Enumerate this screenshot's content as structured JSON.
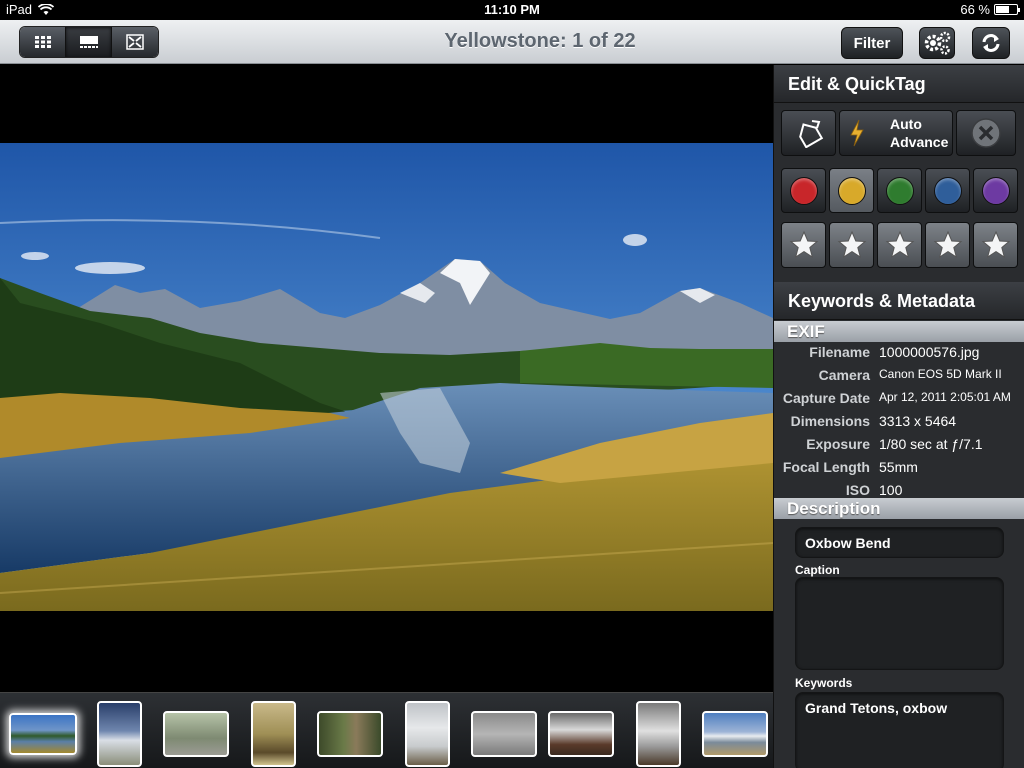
{
  "status_bar": {
    "device": "iPad",
    "time": "11:10 PM",
    "battery_text": "66 %",
    "battery_level": 0.66
  },
  "toolbar": {
    "title": "Yellowstone: 1 of 22",
    "filter_label": "Filter",
    "view_modes": [
      "grid-view",
      "single-view",
      "fullscreen-view"
    ],
    "active_view": "single-view"
  },
  "panel": {
    "header": "Edit & QuickTag",
    "auto_advance_line1": "Auto",
    "auto_advance_line2": "Advance",
    "color_labels": [
      {
        "name": "red",
        "color": "#c8262a"
      },
      {
        "name": "yellow",
        "color": "#d8a92a"
      },
      {
        "name": "green",
        "color": "#2f7c2f"
      },
      {
        "name": "blue",
        "color": "#2f5e9a"
      },
      {
        "name": "purple",
        "color": "#6d3aa2"
      }
    ],
    "selected_color": "yellow",
    "stars_total": 5,
    "keywords_header": "Keywords & Metadata",
    "exif_title": "EXIF",
    "exif": [
      {
        "label": "Filename",
        "value": "1000000576.jpg"
      },
      {
        "label": "Camera",
        "value": "Canon EOS 5D Mark II"
      },
      {
        "label": "Capture Date",
        "value": "Apr 12, 2011 2:05:01 AM"
      },
      {
        "label": "Dimensions",
        "value": "3313 x 5464"
      },
      {
        "label": "Exposure",
        "value": "1/80 sec at ƒ/7.1"
      },
      {
        "label": "Focal Length",
        "value": "55mm"
      },
      {
        "label": "ISO",
        "value": "100"
      }
    ],
    "description_title": "Description",
    "title_value": "Oxbow Bend",
    "caption_label": "Caption",
    "caption_value": "",
    "keywords_label": "Keywords",
    "keywords_value": "Grand Tetons, oxbow"
  },
  "accent": {
    "toolbar_title_color": "#5d6670",
    "panel_bg": "#2a2c2f",
    "section_bar": "#b0b5bb"
  }
}
